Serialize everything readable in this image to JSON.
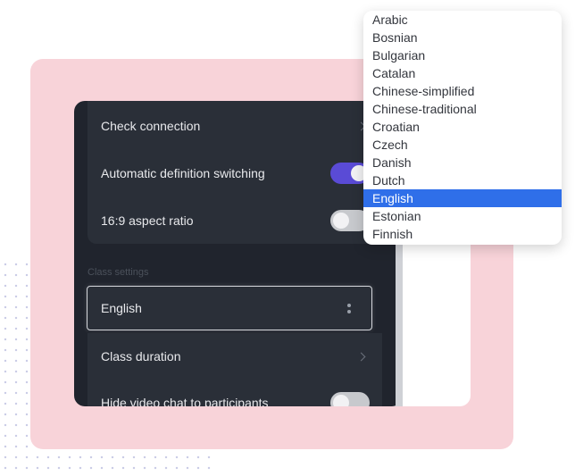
{
  "settings": {
    "check_connection": "Check connection",
    "auto_definition": "Automatic definition switching",
    "aspect_ratio": "16:9 aspect ratio",
    "class_settings_title": "Class settings",
    "language_selected": "English",
    "class_duration": "Class duration",
    "hide_video_chat": "Hide video chat to participants"
  },
  "toggles": {
    "auto_definition_on": true,
    "aspect_ratio_on": false,
    "hide_video_chat_on": false
  },
  "dropdown": {
    "options": [
      "Arabic",
      "Bosnian",
      "Bulgarian",
      "Catalan",
      "Chinese-simplified",
      "Chinese-traditional",
      "Croatian",
      "Czech",
      "Danish",
      "Dutch",
      "English",
      "Estonian",
      "Finnish"
    ],
    "selected": "English"
  },
  "colors": {
    "accent": "#5a4bd6",
    "selection": "#2f6fe9",
    "pink_bg": "#f8d3d9"
  }
}
